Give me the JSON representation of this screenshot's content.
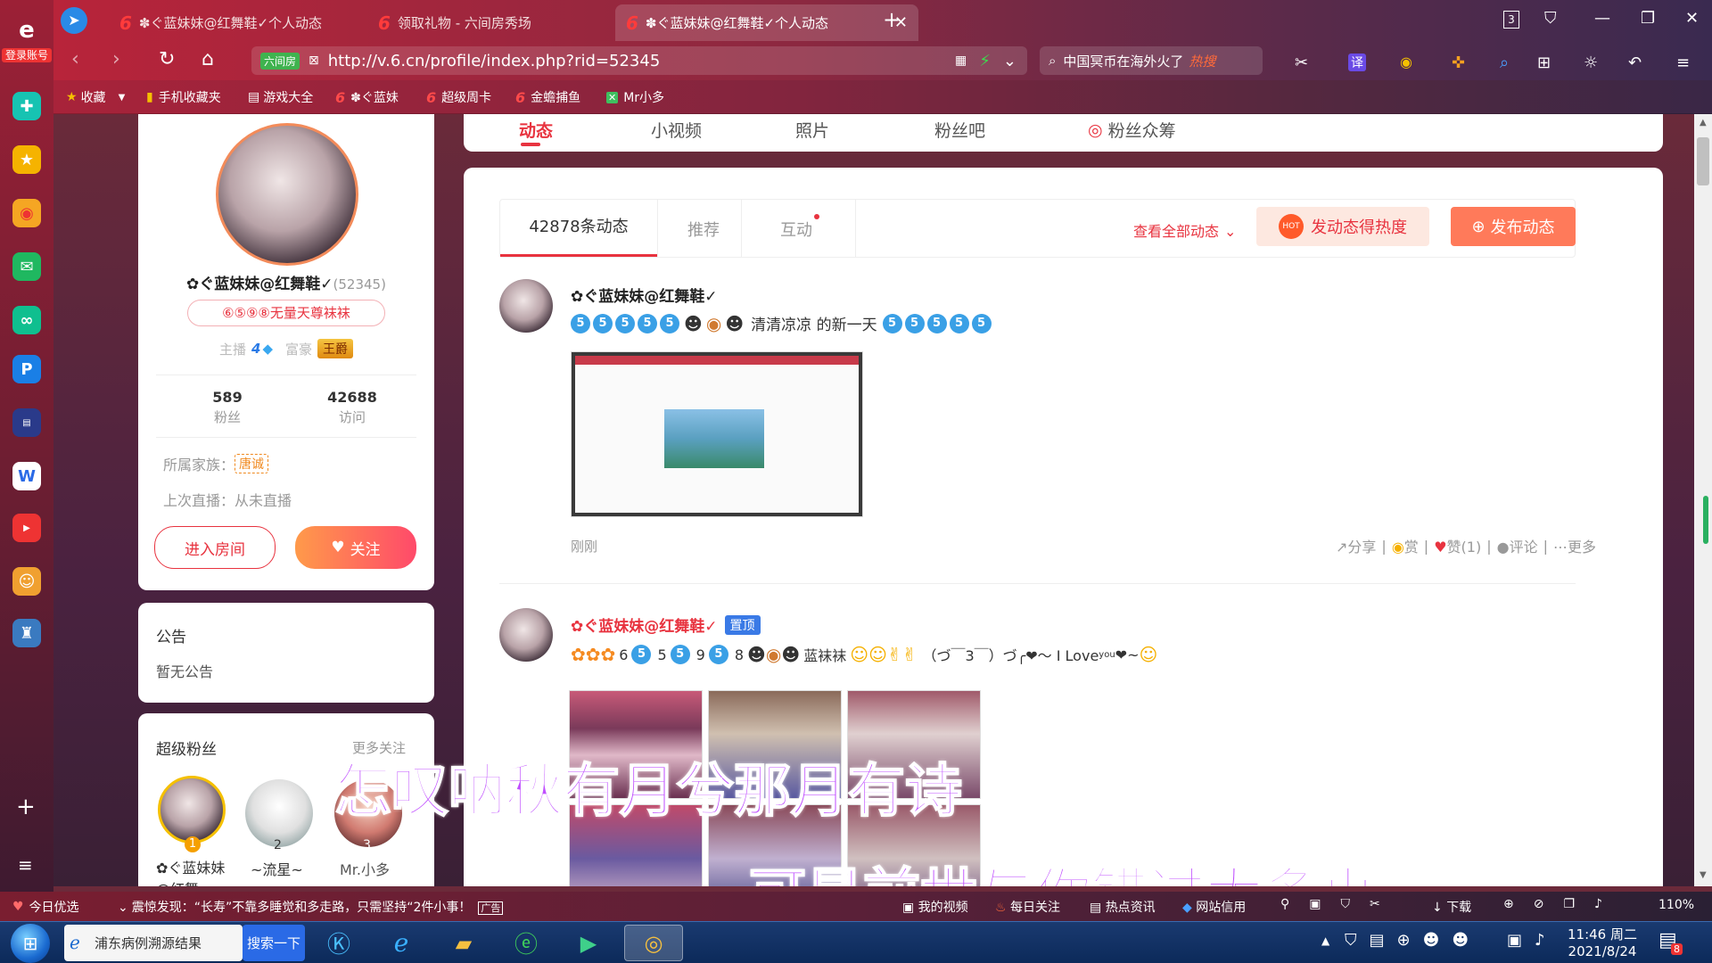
{
  "left_rail": {
    "account_label": "登录账号"
  },
  "tabs": [
    {
      "label": "✽ぐ蓝妹妹@红舞鞋✓个人动态",
      "active": false
    },
    {
      "label": "领取礼物 - 六间房秀场",
      "active": false
    },
    {
      "label": "✽ぐ蓝妹妹@红舞鞋✓个人动态",
      "active": true
    }
  ],
  "tab_count_badge": "3",
  "address": {
    "secure_label": "六间房",
    "url": "http://v.6.cn/profile/index.php?rid=52345"
  },
  "search": {
    "text": "中国冥币在海外火了",
    "hot_tag": "热搜"
  },
  "bookmarks": [
    "收藏",
    "手机收藏夹",
    "游戏大全",
    "✽ぐ蓝妹",
    "超级周卡",
    "金蟾捕鱼",
    "Mr小多"
  ],
  "profile_tabs": [
    "动态",
    "小视频",
    "照片",
    "粉丝吧",
    "粉丝众筹"
  ],
  "profile": {
    "name": "✿ぐ蓝妹妹@红舞鞋✓",
    "rid": "(52345)",
    "title_badge": "⑥⑤⑨⑧无量天尊袜袜",
    "host_label": "主播",
    "host_level": "4",
    "rich_label": "富豪",
    "rich_badge": "王爵",
    "fans_count": "589",
    "fans_label": "粉丝",
    "visits_count": "42688",
    "visits_label": "访问",
    "family_label": "所属家族：",
    "family_badge": "唐诚",
    "last_live": "上次直播：从未直播",
    "enter_room": "进入房间",
    "follow": "关注"
  },
  "notice": {
    "title": "公告",
    "text": "暂无公告"
  },
  "super_fans": {
    "title": "超级粉丝",
    "more": "更多关注",
    "fans": [
      {
        "rank": "1",
        "name": "✿ぐ蓝妹妹@红舞"
      },
      {
        "rank": "2",
        "name": "~流星~"
      },
      {
        "rank": "3",
        "name": "Mr.小多"
      }
    ]
  },
  "feed_tabs": {
    "count_tab": "42878条动态",
    "recommend": "推荐",
    "interact": "互动",
    "view_all": "查看全部动态",
    "heat_button": "发动态得热度",
    "hot_tag": "HOT",
    "publish_button": "发布动态"
  },
  "posts": [
    {
      "author": "✿ぐ蓝妹妹@红舞鞋✓",
      "text": "清清凉凉 的新一天",
      "time": "刚刚",
      "actions": {
        "share": "分享",
        "reward": "赏",
        "like": "赞(1)",
        "comment": "评论",
        "more": "更多"
      }
    },
    {
      "author": "✿ぐ蓝妹妹@红舞鞋✓",
      "pinned": "置顶",
      "text_parts": [
        "6",
        "5",
        "9",
        "8",
        "蓝袜袜",
        "（づ￣3￣）づ╭❤～ I  Love",
        "you",
        "❤~"
      ]
    }
  ],
  "lyrics": [
    "怎叹呐秋有月兮那月有诗",
    "可是前世与你错过太多事"
  ],
  "statusbar": {
    "left": "今日优选",
    "news": "震惊发现：“长寿”不靠多睡觉和多走路，只需坚持“2件小事！",
    "ad": "广告",
    "items": [
      "我的视频",
      "每日关注",
      "热点资讯",
      "网站信用",
      "下载"
    ],
    "zoom": "110%"
  },
  "taskbar": {
    "task1": "浦东病例溯源结果",
    "task1_btn": "搜索一下",
    "time": "11:46 周二",
    "date": "2021/8/24",
    "notif": "8"
  }
}
